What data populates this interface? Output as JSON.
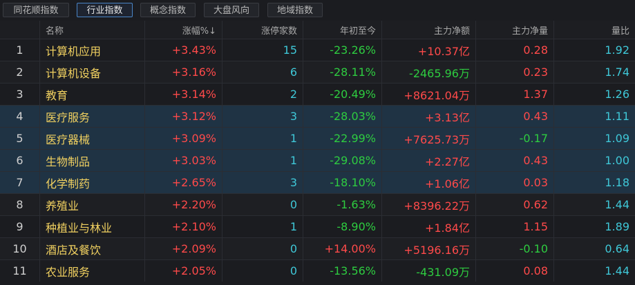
{
  "tabs": [
    {
      "label": "同花顺指数",
      "active": false
    },
    {
      "label": "行业指数",
      "active": true
    },
    {
      "label": "概念指数",
      "active": false
    },
    {
      "label": "大盘风向",
      "active": false
    },
    {
      "label": "地域指数",
      "active": false
    }
  ],
  "columns": [
    "",
    "名称",
    "涨幅%↓",
    "涨停家数",
    "年初至今",
    "主力净额",
    "主力净量",
    "量比"
  ],
  "rows": [
    {
      "idx": "1",
      "name": "计算机应用",
      "chg": "+3.43%",
      "limit_up": "15",
      "ytd": "-23.26%",
      "net_amt": "+10.37亿",
      "net_vol": "0.28",
      "ratio": "1.92"
    },
    {
      "idx": "2",
      "name": "计算机设备",
      "chg": "+3.16%",
      "limit_up": "6",
      "ytd": "-28.11%",
      "net_amt": "-2465.96万",
      "net_vol": "0.23",
      "ratio": "1.74"
    },
    {
      "idx": "3",
      "name": "教育",
      "chg": "+3.14%",
      "limit_up": "2",
      "ytd": "-20.49%",
      "net_amt": "+8621.04万",
      "net_vol": "1.37",
      "ratio": "1.26"
    },
    {
      "idx": "4",
      "name": "医疗服务",
      "chg": "+3.12%",
      "limit_up": "3",
      "ytd": "-28.03%",
      "net_amt": "+3.13亿",
      "net_vol": "0.43",
      "ratio": "1.11"
    },
    {
      "idx": "5",
      "name": "医疗器械",
      "chg": "+3.09%",
      "limit_up": "1",
      "ytd": "-22.99%",
      "net_amt": "+7625.73万",
      "net_vol": "-0.17",
      "ratio": "1.09"
    },
    {
      "idx": "6",
      "name": "生物制品",
      "chg": "+3.03%",
      "limit_up": "1",
      "ytd": "-29.08%",
      "net_amt": "+2.27亿",
      "net_vol": "0.43",
      "ratio": "1.00"
    },
    {
      "idx": "7",
      "name": "化学制药",
      "chg": "+2.65%",
      "limit_up": "3",
      "ytd": "-18.10%",
      "net_amt": "+1.06亿",
      "net_vol": "0.03",
      "ratio": "1.18"
    },
    {
      "idx": "8",
      "name": "养殖业",
      "chg": "+2.20%",
      "limit_up": "0",
      "ytd": "-1.63%",
      "net_amt": "+8396.22万",
      "net_vol": "0.62",
      "ratio": "1.44"
    },
    {
      "idx": "9",
      "name": "种植业与林业",
      "chg": "+2.10%",
      "limit_up": "1",
      "ytd": "-8.90%",
      "net_amt": "+1.84亿",
      "net_vol": "1.15",
      "ratio": "1.89"
    },
    {
      "idx": "10",
      "name": "酒店及餐饮",
      "chg": "+2.09%",
      "limit_up": "0",
      "ytd": "+14.00%",
      "net_amt": "+5196.16万",
      "net_vol": "-0.10",
      "ratio": "0.64"
    },
    {
      "idx": "11",
      "name": "农业服务",
      "chg": "+2.05%",
      "limit_up": "0",
      "ytd": "-13.56%",
      "net_amt": "-431.09万",
      "net_vol": "0.08",
      "ratio": "1.44"
    }
  ],
  "colors": {
    "up": "#ff4a4a",
    "down": "#2ecc40",
    "name": "#f0d060",
    "neutral": "#3fc8d8",
    "selected_bg": "#1f3344"
  }
}
